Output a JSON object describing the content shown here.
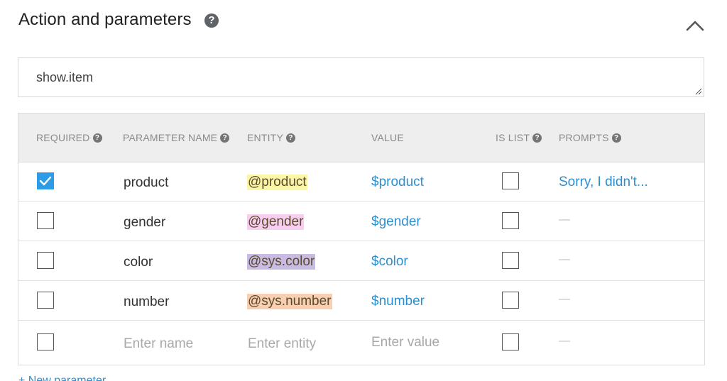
{
  "section": {
    "title": "Action and parameters",
    "help_icon": "question-circle-icon",
    "collapse_icon": "chevron-up-icon"
  },
  "action": {
    "value": "show.item"
  },
  "table": {
    "headers": {
      "required": "REQUIRED",
      "parameter_name": "PARAMETER NAME",
      "entity": "ENTITY",
      "value": "VALUE",
      "is_list": "IS LIST",
      "prompts": "PROMPTS"
    },
    "rows": [
      {
        "required": true,
        "name": "product",
        "entity": "@product",
        "entity_color": "#fbf5a6",
        "value": "$product",
        "is_list": false,
        "prompts": "Sorry, I didn't..."
      },
      {
        "required": false,
        "name": "gender",
        "entity": "@gender",
        "entity_color": "#f7cdf0",
        "value": "$gender",
        "is_list": false,
        "prompts": "—"
      },
      {
        "required": false,
        "name": "color",
        "entity": "@sys.color",
        "entity_color": "#c9bce3",
        "value": "$color",
        "is_list": false,
        "prompts": "—"
      },
      {
        "required": false,
        "name": "number",
        "entity": "@sys.number",
        "entity_color": "#f9cfb1",
        "value": "$number",
        "is_list": false,
        "prompts": "—"
      }
    ],
    "new_row": {
      "name_placeholder": "Enter name",
      "entity_placeholder": "Enter entity",
      "value_placeholder": "Enter value",
      "prompts": "—"
    }
  },
  "footer": {
    "new_parameter_label": "+ New parameter"
  },
  "colors": {
    "accent_blue": "#2e9be6",
    "link_blue": "#2e8fcf",
    "header_bg": "#eeeeee"
  }
}
